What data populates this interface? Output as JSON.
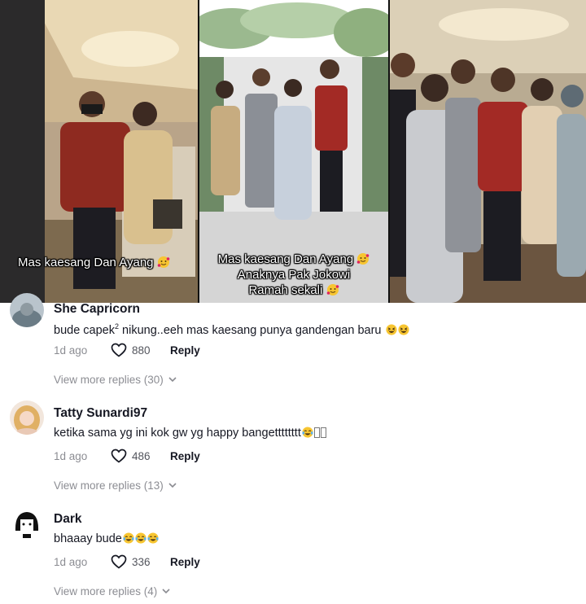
{
  "video_strip": {
    "frames": [
      {
        "caption": "Mas kaesang Dan Ayang"
      },
      {
        "caption_line1": "Mas kaesang Dan Ayang",
        "caption_line2": "Anaknya Pak Jokowi",
        "caption_line3": "Ramah sekali"
      },
      {
        "caption": ""
      }
    ]
  },
  "comments": [
    {
      "username": "She Capricorn",
      "text_before": "bude capek",
      "text_sup": "2",
      "text_after": " nikung..eeh mas kaesang punya gandengan baru ",
      "emoji": [
        "grinning-squint-emoji",
        "grinning-squint-emoji"
      ],
      "time": "1d ago",
      "likes": "880",
      "reply_label": "Reply",
      "view_more": "View more replies (30)"
    },
    {
      "username": "Tatty Sunardi97",
      "text": "ketika sama yg ini kok gw yg happy bangetttttttt",
      "emoji": [
        "tears-of-joy-emoji"
      ],
      "time": "1d ago",
      "likes": "486",
      "reply_label": "Reply",
      "view_more": "View more replies (13)"
    },
    {
      "username": "Dark",
      "text": "bhaaay bude",
      "emoji": [
        "tears-of-joy-emoji",
        "tears-of-joy-emoji",
        "tears-of-joy-emoji"
      ],
      "time": "1d ago",
      "likes": "336",
      "reply_label": "Reply",
      "view_more": "View more replies (4)"
    }
  ],
  "colors": {
    "text_primary": "#161823",
    "text_muted": "#8a8b91",
    "emoji_yellow": "#f7c531"
  }
}
